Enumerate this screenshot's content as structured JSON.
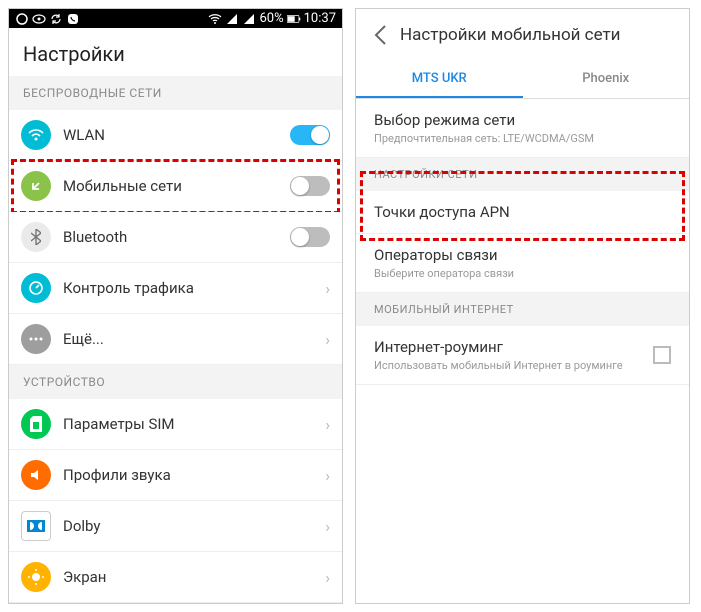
{
  "statusbar": {
    "battery_pct": "60%",
    "time": "10:37"
  },
  "left": {
    "title": "Настройки",
    "section_wireless": "БЕСПРОВОДНЫЕ СЕТИ",
    "section_device": "УСТРОЙСТВО",
    "items": {
      "wlan": "WLAN",
      "mobile": "Мобильные сети",
      "bluetooth": "Bluetooth",
      "traffic": "Контроль трафика",
      "more": "Ещё...",
      "sim": "Параметры SIM",
      "sound": "Профили звука",
      "dolby": "Dolby",
      "screen": "Экран"
    }
  },
  "right": {
    "title": "Настройки мобильной сети",
    "tabs": {
      "mts": "MTS UKR",
      "phoenix": "Phoenix"
    },
    "mode": {
      "title": "Выбор режима сети",
      "sub": "Предпочтительная сеть: LTE/WCDMA/GSM"
    },
    "section_net": "НАСТРОЙКИ СЕТИ",
    "apn": "Точки доступа APN",
    "operators": {
      "title": "Операторы связи",
      "sub": "Выберите оператора связи"
    },
    "section_inet": "МОБИЛЬНЫЙ ИНТЕРНЕТ",
    "roaming": {
      "title": "Интернет-роуминг",
      "sub": "Использовать мобильный Интернет в роуминге"
    }
  }
}
